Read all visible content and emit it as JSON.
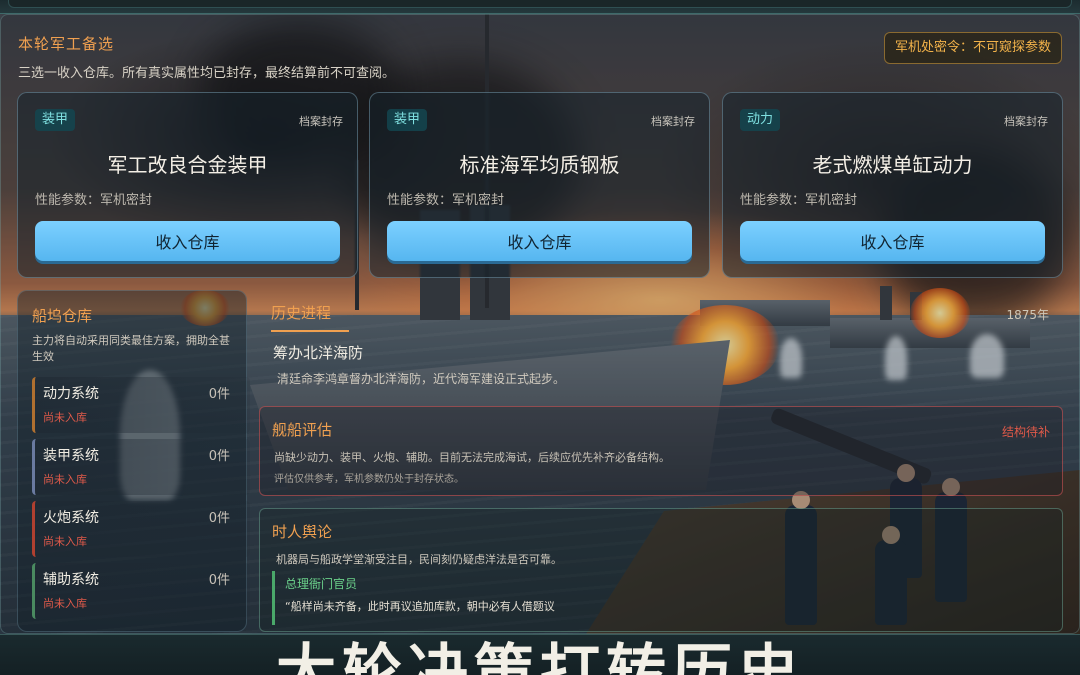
{
  "header": {
    "section_title": "本轮军工备选",
    "section_desc": "三选一收入仓库。所有真实属性均已封存，最终结算前不可查阅。",
    "secret_badge": "军机处密令：不可窥探参数"
  },
  "cards": [
    {
      "tag": "装甲",
      "archive": "档案封存",
      "name": "军工改良合金装甲",
      "spec": "性能参数：军机密封",
      "button": "收入仓库"
    },
    {
      "tag": "装甲",
      "archive": "档案封存",
      "name": "标准海军均质钢板",
      "spec": "性能参数：军机密封",
      "button": "收入仓库"
    },
    {
      "tag": "动力",
      "archive": "档案封存",
      "name": "老式燃煤单缸动力",
      "spec": "性能参数：军机密封",
      "button": "收入仓库"
    }
  ],
  "shipyard": {
    "title": "船坞仓库",
    "desc": "主力将自动采用同类最佳方案，拥助全甚生效",
    "slots": [
      {
        "name": "动力系统",
        "count": "0件",
        "status": "尚未入库"
      },
      {
        "name": "装甲系统",
        "count": "0件",
        "status": "尚未入库"
      },
      {
        "name": "火炮系统",
        "count": "0件",
        "status": "尚未入库"
      },
      {
        "name": "辅助系统",
        "count": "0件",
        "status": "尚未入库"
      }
    ]
  },
  "history": {
    "title": "历史进程",
    "year": "1875年",
    "event_title": "筹办北洋海防",
    "event_desc": "清廷命李鸿章督办北洋海防，近代海军建设正式起步。"
  },
  "evaluation": {
    "title": "舰船评估",
    "flag": "结构待补",
    "desc": "尚缺少动力、装甲、火炮、辅助。目前无法完成海试，后续应优先补齐必备结构。",
    "note": "评估仅供参考，军机参数仍处于封存状态。"
  },
  "opinion": {
    "title": "时人舆论",
    "desc": "机器局与船政学堂渐受注目，民间刻仍疑虑洋法是否可靠。",
    "quote_speaker": "总理衙门官员",
    "quote_text": "“船样尚未齐备，此时再议追加库款，朝中必有人借题议"
  },
  "banner": {
    "text": "大轮决策打转历史"
  },
  "colors": {
    "accent": "#f0a050",
    "button": "#56b6f0",
    "warning": "#e05a4a",
    "tag": "#7fe0e0"
  }
}
